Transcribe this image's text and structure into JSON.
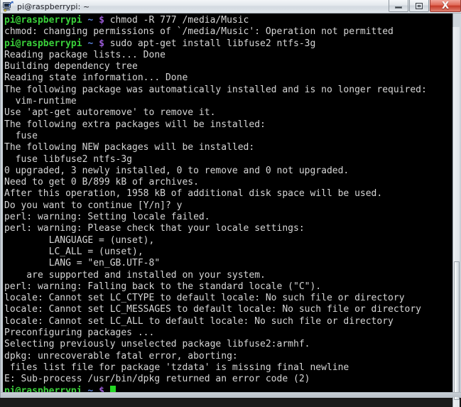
{
  "window": {
    "title": "pi@raspberrypi: ~",
    "icon": "putty-terminal-icon",
    "buttons": {
      "minimize": "–",
      "restore": "❐",
      "close": "X"
    }
  },
  "colors": {
    "terminal_background": "#000000",
    "output_text": "#d6d6d6",
    "prompt_user": "#3ad13a",
    "prompt_path": "#5a7fd6",
    "prompt_symbol": "#9a5ad6",
    "cursor": "#23d723",
    "close_button": "#c53a28"
  },
  "terminal": {
    "prompt": {
      "user": "pi@raspberrypi",
      "path": "~",
      "symbol": "$"
    },
    "lines": [
      {
        "type": "prompt",
        "command": " chmod -R 777 /media/Music"
      },
      {
        "type": "output",
        "text": "chmod: changing permissions of `/media/Music': Operation not permitted"
      },
      {
        "type": "prompt",
        "command": " sudo apt-get install libfuse2 ntfs-3g"
      },
      {
        "type": "output",
        "text": "Reading package lists... Done"
      },
      {
        "type": "output",
        "text": "Building dependency tree"
      },
      {
        "type": "output",
        "text": "Reading state information... Done"
      },
      {
        "type": "output",
        "text": "The following package was automatically installed and is no longer required:"
      },
      {
        "type": "output",
        "text": "  vim-runtime"
      },
      {
        "type": "output",
        "text": "Use 'apt-get autoremove' to remove it."
      },
      {
        "type": "output",
        "text": "The following extra packages will be installed:"
      },
      {
        "type": "output",
        "text": "  fuse"
      },
      {
        "type": "output",
        "text": "The following NEW packages will be installed:"
      },
      {
        "type": "output",
        "text": "  fuse libfuse2 ntfs-3g"
      },
      {
        "type": "output",
        "text": "0 upgraded, 3 newly installed, 0 to remove and 0 not upgraded."
      },
      {
        "type": "output",
        "text": "Need to get 0 B/899 kB of archives."
      },
      {
        "type": "output",
        "text": "After this operation, 1958 kB of additional disk space will be used."
      },
      {
        "type": "output",
        "text": "Do you want to continue [Y/n]? y"
      },
      {
        "type": "output",
        "text": "perl: warning: Setting locale failed."
      },
      {
        "type": "output",
        "text": "perl: warning: Please check that your locale settings:"
      },
      {
        "type": "output",
        "text": "        LANGUAGE = (unset),"
      },
      {
        "type": "output",
        "text": "        LC_ALL = (unset),"
      },
      {
        "type": "output",
        "text": "        LANG = \"en_GB.UTF-8\""
      },
      {
        "type": "output",
        "text": "    are supported and installed on your system."
      },
      {
        "type": "output",
        "text": "perl: warning: Falling back to the standard locale (\"C\")."
      },
      {
        "type": "output",
        "text": "locale: Cannot set LC_CTYPE to default locale: No such file or directory"
      },
      {
        "type": "output",
        "text": "locale: Cannot set LC_MESSAGES to default locale: No such file or directory"
      },
      {
        "type": "output",
        "text": "locale: Cannot set LC_ALL to default locale: No such file or directory"
      },
      {
        "type": "output",
        "text": "Preconfiguring packages ..."
      },
      {
        "type": "output",
        "text": "Selecting previously unselected package libfuse2:armhf."
      },
      {
        "type": "output",
        "text": "dpkg: unrecoverable fatal error, aborting:"
      },
      {
        "type": "output",
        "text": " files list file for package 'tzdata' is missing final newline"
      },
      {
        "type": "output",
        "text": "E: Sub-process /usr/bin/dpkg returned an error code (2)"
      },
      {
        "type": "cursor-prompt",
        "command": " "
      }
    ]
  }
}
